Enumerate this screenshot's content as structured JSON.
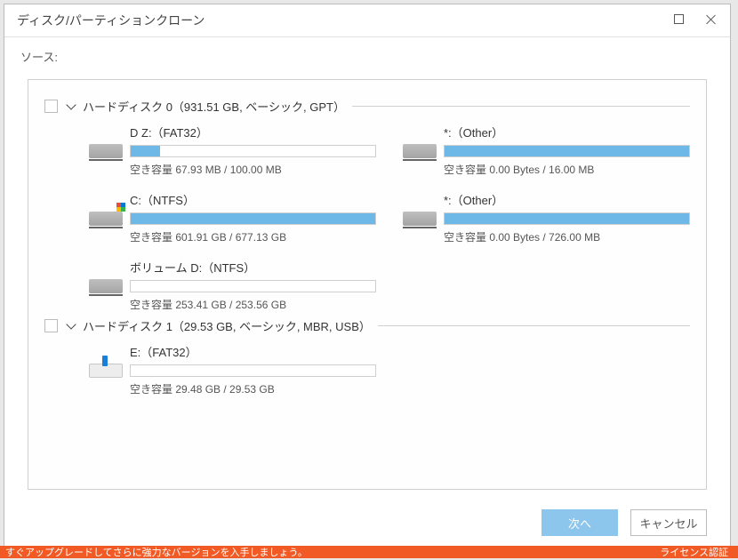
{
  "window": {
    "title": "ディスク/パーティションクローン"
  },
  "source_label": "ソース:",
  "free_prefix": "空き容量",
  "disks": [
    {
      "header": "ハードディスク 0（931.51 GB, ベーシック, GPT）",
      "partitions": [
        {
          "name": "D Z:（FAT32）",
          "free": "67.93 MB",
          "total": "100.00 MB",
          "fillPct": 12,
          "icon": "hdd"
        },
        {
          "name": "*:（Other）",
          "free": "0.00 Bytes",
          "total": "16.00 MB",
          "fillPct": 100,
          "icon": "hdd"
        },
        {
          "name": "C:（NTFS）",
          "free": "601.91 GB",
          "total": "677.13 GB",
          "fillPct": 100,
          "icon": "hdd-win"
        },
        {
          "name": "*:（Other）",
          "free": "0.00 Bytes",
          "total": "726.00 MB",
          "fillPct": 100,
          "icon": "hdd"
        },
        {
          "name": "ボリューム D:（NTFS）",
          "free": "253.41 GB",
          "total": "253.56 GB",
          "fillPct": 0,
          "icon": "hdd"
        }
      ]
    },
    {
      "header": "ハードディスク 1（29.53 GB, ベーシック, MBR, USB）",
      "partitions": [
        {
          "name": "E:（FAT32）",
          "free": "29.48 GB",
          "total": "29.53 GB",
          "fillPct": 0,
          "icon": "usb"
        }
      ]
    }
  ],
  "buttons": {
    "next": "次へ",
    "cancel": "キャンセル"
  },
  "strip": {
    "left": "すぐアップグレードしてさらに強力なバージョンを入手しましょう。",
    "right": "ライセンス認証"
  }
}
